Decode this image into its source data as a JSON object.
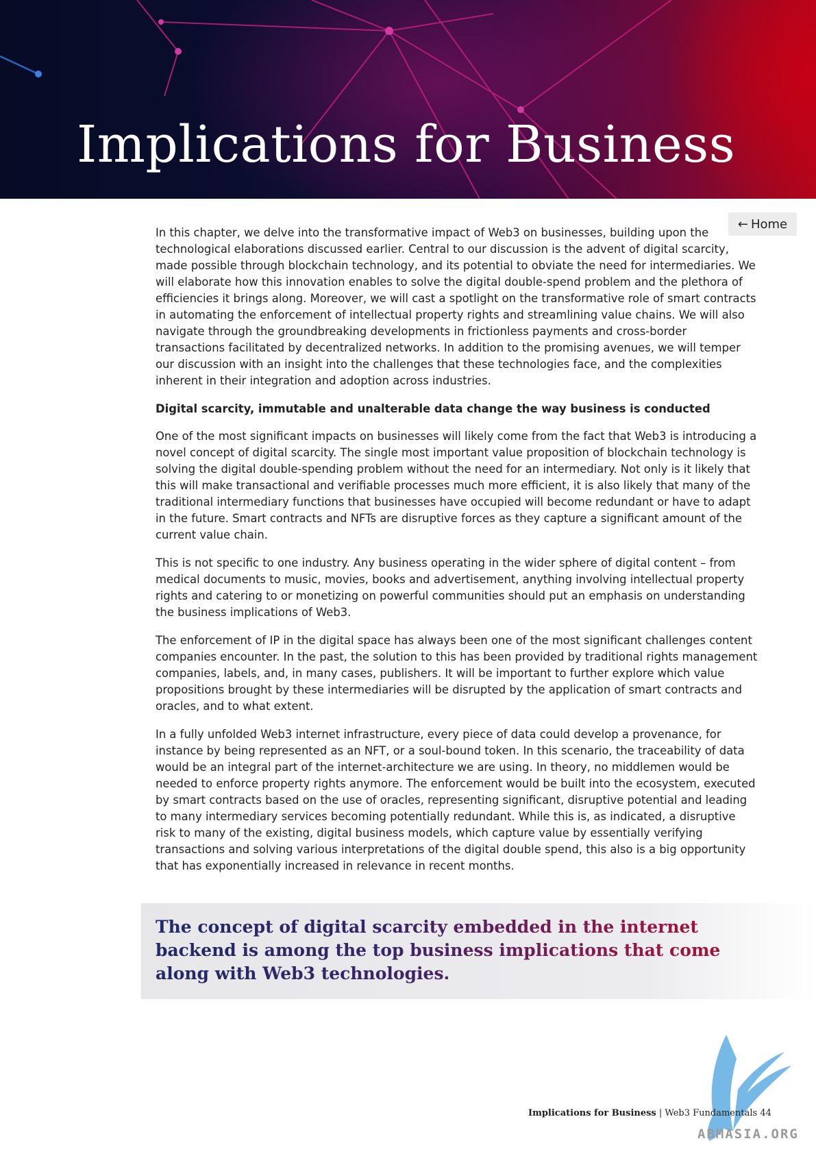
{
  "header": {
    "title": "Implications for Business"
  },
  "nav": {
    "home_label": "Home"
  },
  "body": {
    "intro": "In this chapter, we delve into the transformative impact of Web3 on businesses, building upon the technological elaborations discussed earlier. Central to our discussion is the advent of digital scarcity, made possible through blockchain technology, and its potential to obviate the need for intermediaries. We will elaborate how this innovation enables to solve the digital double-spend problem and the plethora of efficiencies it brings along. Moreover, we will cast a spotlight on the transformative role of smart contracts in automating the enforcement of intellectual property rights and streamlining value chains. We will also navigate through the groundbreaking developments in frictionless payments and cross-border transactions facilitated by decentralized networks. In addition to the promising avenues, we will temper our discussion with an insight into the challenges that these technologies face, and the complexities inherent in their integration and adoption across industries.",
    "subheading": "Digital scarcity, immutable and unalterable data change the way business is conducted",
    "paragraphs": [
      "One of the most significant impacts on businesses will likely come from the fact that Web3 is introducing a novel concept of digital scarcity. The single most important value proposition of blockchain technology is solving the digital double-spending problem without the need for an intermediary. Not only is it likely that this will make transactional and verifiable processes much more efficient, it is also likely that many of the traditional intermediary functions that businesses have occupied will become redundant or have to adapt in the future. Smart contracts and NFTs are disruptive forces as they capture a significant amount of the current value chain.",
      "This is not specific to one industry. Any business operating in the wider sphere of digital content – from medical documents to music, movies, books and advertisement, anything involving intellectual property rights and catering to or monetizing on powerful communities should put an emphasis on understanding the business implications of Web3.",
      "The enforcement of IP in the digital space has always been one of the most significant challenges content companies encounter. In the past, the solution to this has been provided by traditional rights management companies, labels, and, in many cases, publishers. It will be important to further explore which value propositions brought by these intermediaries will be disrupted by the application of smart contracts and oracles, and to what extent.",
      "In a fully unfolded Web3 internet infrastructure, every piece of data could develop a provenance, for instance by being represented as an NFT, or a soul-bound token. In this scenario, the traceability of data would be an integral part of the internet-architecture we are using. In theory, no middlemen would be needed to enforce property rights anymore. The enforcement would be built into the ecosystem, executed by smart contracts based on the use of oracles, representing significant, disruptive potential and leading to many intermediary services becoming potentially redundant. While this is, as indicated, a disruptive risk to many of the existing, digital business models, which capture value by essentially verifying transactions and solving various interpretations of the digital double spend, this also is a big opportunity that has exponentially increased in relevance in recent months."
    ]
  },
  "callout": {
    "text": "The concept of digital scarcity embedded in the internet backend is among the top business implications that come along with Web3 technologies."
  },
  "footer": {
    "section": "Implications for Business",
    "separator": "|",
    "publication": "Web3 Fundamentals",
    "page": "44"
  },
  "watermark": {
    "text": "ABMASIA.ORG"
  },
  "colors": {
    "hero_left": "#070b26",
    "hero_right": "#b0061a",
    "callout_start": "#1f2a66",
    "callout_end": "#b0102e",
    "logo_blue": "#6fb6e6"
  }
}
